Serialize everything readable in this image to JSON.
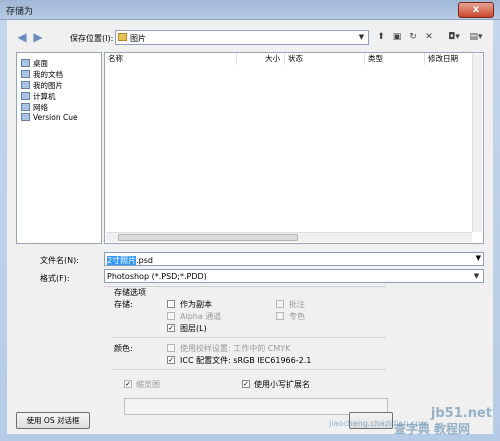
{
  "window": {
    "title": "存储为",
    "close_label": "x"
  },
  "toolbar": {
    "back_icon": "back-arrow-icon",
    "forward_icon": "forward-arrow-icon",
    "save_in_label": "保存位置(I):",
    "save_in_value": "图片"
  },
  "places": [
    {
      "label": "桌面",
      "icon": "desktop-icon"
    },
    {
      "label": "我的文档",
      "icon": "documents-icon"
    },
    {
      "label": "我的图片",
      "icon": "pictures-icon"
    },
    {
      "label": "计算机",
      "icon": "computer-icon"
    },
    {
      "label": "网络",
      "icon": "network-icon"
    },
    {
      "label": "Version Cue",
      "icon": "version-cue-icon"
    }
  ],
  "columns": [
    "名称",
    "大小",
    "状态",
    "类型",
    "修改日期"
  ],
  "filename": {
    "label": "文件名(N):",
    "selected": "2寸照片",
    "rest": ".psd"
  },
  "format": {
    "label": "格式(F):",
    "value": "Photoshop (*.PSD;*.PDD)"
  },
  "options": {
    "title": "存储选项",
    "save_label": "存储:",
    "as_copy": "作为副本",
    "annotations": "批注",
    "alpha": "Alpha 通道",
    "spot": "专色",
    "layers": "图层(L)",
    "color_label": "颜色:",
    "proof": "使用校样设置: 工作中的 CMYK",
    "icc": "ICC 配置文件: sRGB IEC61966-2.1",
    "thumbnail": "缩览图",
    "lowercase": "使用小写扩展名"
  },
  "buttons": {
    "os_dialog": "使用 OS 对话框"
  },
  "watermark": {
    "site": "jb51.net",
    "sub": "查字典 教程网",
    "url": "jiaocheng.chazidian.com"
  }
}
